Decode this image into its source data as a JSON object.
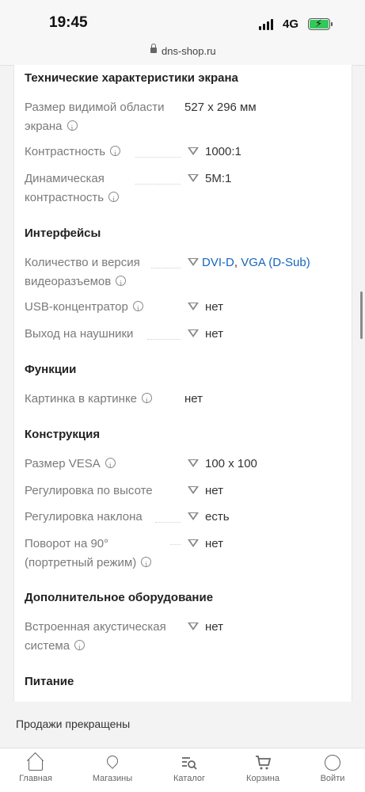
{
  "status_bar": {
    "time": "19:45",
    "network": "4G"
  },
  "browser": {
    "url": "dns-shop.ru"
  },
  "sections": [
    {
      "title": "Технические характеристики экрана",
      "rows": [
        {
          "label_lines": [
            "Размер видимой области",
            "экрана"
          ],
          "value": "527 x 296 мм"
        },
        {
          "label_lines": [
            "Контрастность"
          ],
          "value": "1000:1"
        },
        {
          "label_lines": [
            "Динамическая",
            "контрастность"
          ],
          "value": "5M:1"
        }
      ]
    },
    {
      "title": "Интерфейсы",
      "rows": [
        {
          "label_lines": [
            "Количество и версия",
            "видеоразъемов"
          ],
          "value_links": [
            "DVI-D",
            "VGA (D-Sub)"
          ],
          "value_sep": ", "
        },
        {
          "label_lines": [
            "USB-концентратор"
          ],
          "value": "нет"
        },
        {
          "label_lines": [
            "Выход на наушники"
          ],
          "value": "нет"
        }
      ]
    },
    {
      "title": "Функции",
      "rows": [
        {
          "label_lines": [
            "Картинка в картинке"
          ],
          "value": "нет"
        }
      ]
    },
    {
      "title": "Конструкция",
      "rows": [
        {
          "label_lines": [
            "Размер VESA"
          ],
          "value": "100 x 100"
        },
        {
          "label_lines": [
            "Регулировка по высоте"
          ],
          "value": "нет"
        },
        {
          "label_lines": [
            "Регулировка наклона"
          ],
          "value": "есть"
        },
        {
          "label_lines": [
            "Поворот на 90°",
            "(портретный режим)"
          ],
          "value": "нет"
        }
      ]
    },
    {
      "title": "Дополнительное оборудование",
      "rows": [
        {
          "label_lines": [
            "Встроенная акустическая",
            "система"
          ],
          "value": "нет"
        }
      ]
    },
    {
      "title": "Питание",
      "rows": []
    }
  ],
  "banner": {
    "text": "Продажи прекращены"
  },
  "tabbar": [
    {
      "label": "Главная",
      "icon": "home-icon"
    },
    {
      "label": "Магазины",
      "icon": "map-pin-icon"
    },
    {
      "label": "Каталог",
      "icon": "catalog-search-icon"
    },
    {
      "label": "Корзина",
      "icon": "cart-icon"
    },
    {
      "label": "Войти",
      "icon": "user-icon"
    }
  ]
}
